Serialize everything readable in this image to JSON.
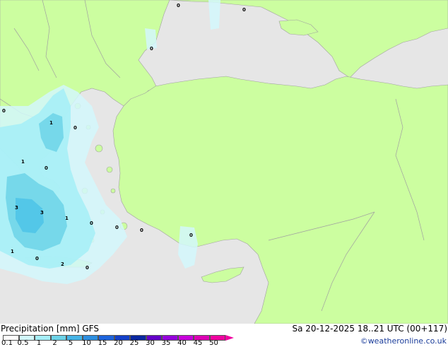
{
  "title_left": "Precipitation [mm] GFS",
  "title_right": "Sa 20-12-2025 18..21 UTC (00+117)",
  "credit": "©weatheronline.co.uk",
  "colors": {
    "sea": "#e6e6e6",
    "land": "#ccfea0",
    "border": "#a0a0a0",
    "precip_light": "#d2f7fb",
    "precip_mid": "#a5eef7",
    "precip_heavy": "#6cd3e8",
    "precip_max": "#4dc4e8"
  },
  "legend": {
    "levels": [
      "0.1",
      "0.5",
      "1",
      "2",
      "5",
      "10",
      "15",
      "20",
      "25",
      "30",
      "35",
      "40",
      "45",
      "50"
    ],
    "colors": [
      "#ffffff",
      "#d2f7fb",
      "#a5eef7",
      "#6cd3e8",
      "#46b4e6",
      "#2e8fe0",
      "#1e64dc",
      "#1440c8",
      "#0a28a0",
      "#6400c8",
      "#9600dc",
      "#c800dc",
      "#dc00b4",
      "#f000a0"
    ]
  },
  "map_labels": [
    "0",
    "0",
    "0",
    "1",
    "0",
    "0",
    "1",
    "0",
    "3",
    "3",
    "1",
    "0",
    "0",
    "0",
    "0",
    "1",
    "0",
    "2",
    "0"
  ]
}
